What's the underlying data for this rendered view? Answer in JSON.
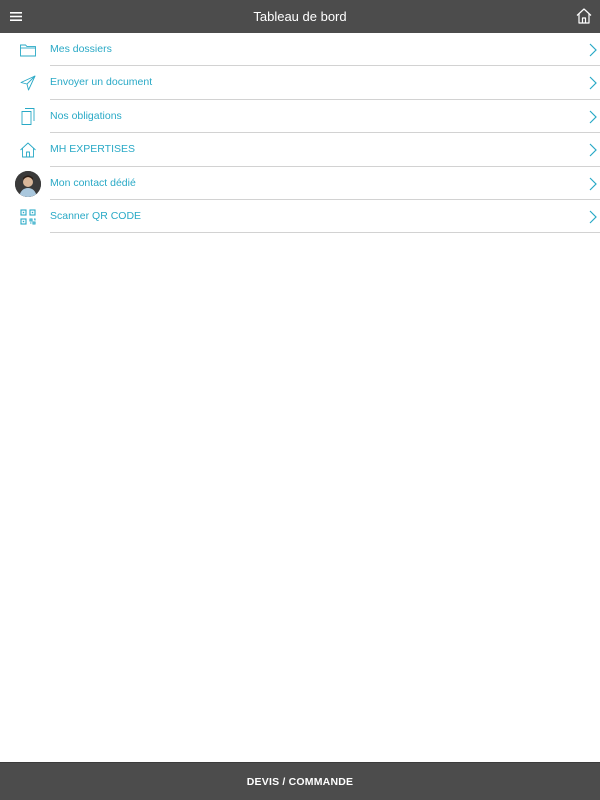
{
  "header": {
    "title": "Tableau de bord",
    "menu_icon": "hamburger-menu-icon",
    "home_icon": "home-icon"
  },
  "menu": {
    "items": [
      {
        "label": "Mes dossiers",
        "icon": "folder-icon"
      },
      {
        "label": "Envoyer un document",
        "icon": "send-paper-plane-icon"
      },
      {
        "label": "Nos obligations",
        "icon": "documents-icon"
      },
      {
        "label": "MH EXPERTISES",
        "icon": "house-icon"
      },
      {
        "label": "Mon contact dédié",
        "icon": "contact-avatar"
      },
      {
        "label": "Scanner QR CODE",
        "icon": "qr-code-icon"
      }
    ]
  },
  "footer": {
    "button_label": "DEVIS / COMMANDE"
  },
  "colors": {
    "bar_background": "#4c4c4c",
    "accent": "#29a9c6",
    "divider": "#d2d2d2",
    "background": "#ffffff"
  }
}
